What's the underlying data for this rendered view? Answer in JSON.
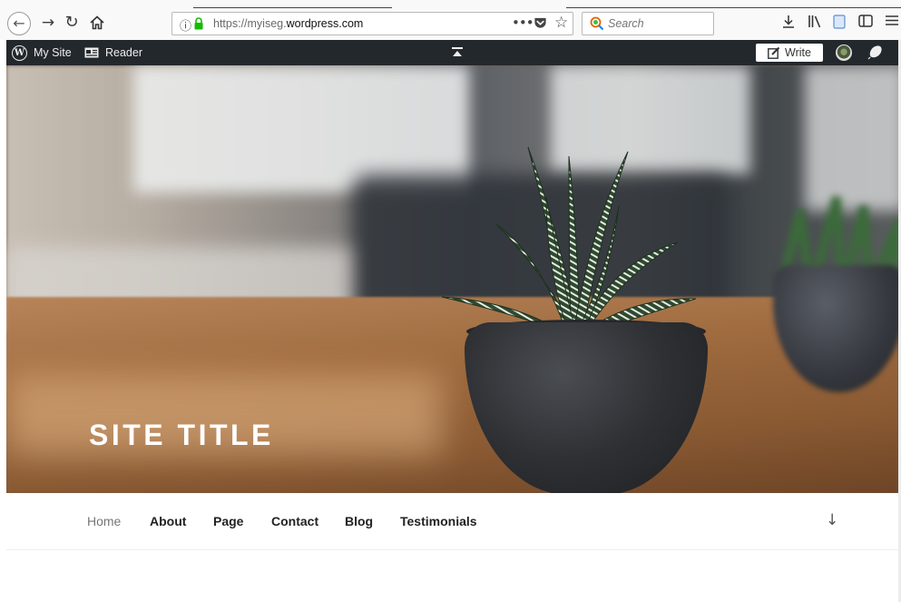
{
  "browser": {
    "url_prefix": "https://myiseg.",
    "url_domain": "wordpress.com",
    "search_placeholder": "Search",
    "icons": [
      "back-icon",
      "forward-icon",
      "reload-icon",
      "home-icon",
      "info-icon",
      "lock-icon",
      "more-icon",
      "pocket-icon",
      "star-icon",
      "search-icon",
      "downloads-icon",
      "library-icon",
      "reader-view-icon",
      "sidebar-icon",
      "menu-icon"
    ]
  },
  "adminbar": {
    "my_site": "My Site",
    "reader": "Reader",
    "write": "Write",
    "color": "#23282d"
  },
  "header": {
    "site_title": "SITE TITLE"
  },
  "nav": {
    "items": [
      {
        "label": "Home"
      },
      {
        "label": "About"
      },
      {
        "label": "Page"
      },
      {
        "label": "Contact"
      },
      {
        "label": "Blog"
      },
      {
        "label": "Testimonials"
      }
    ],
    "current_color": "#767676"
  }
}
